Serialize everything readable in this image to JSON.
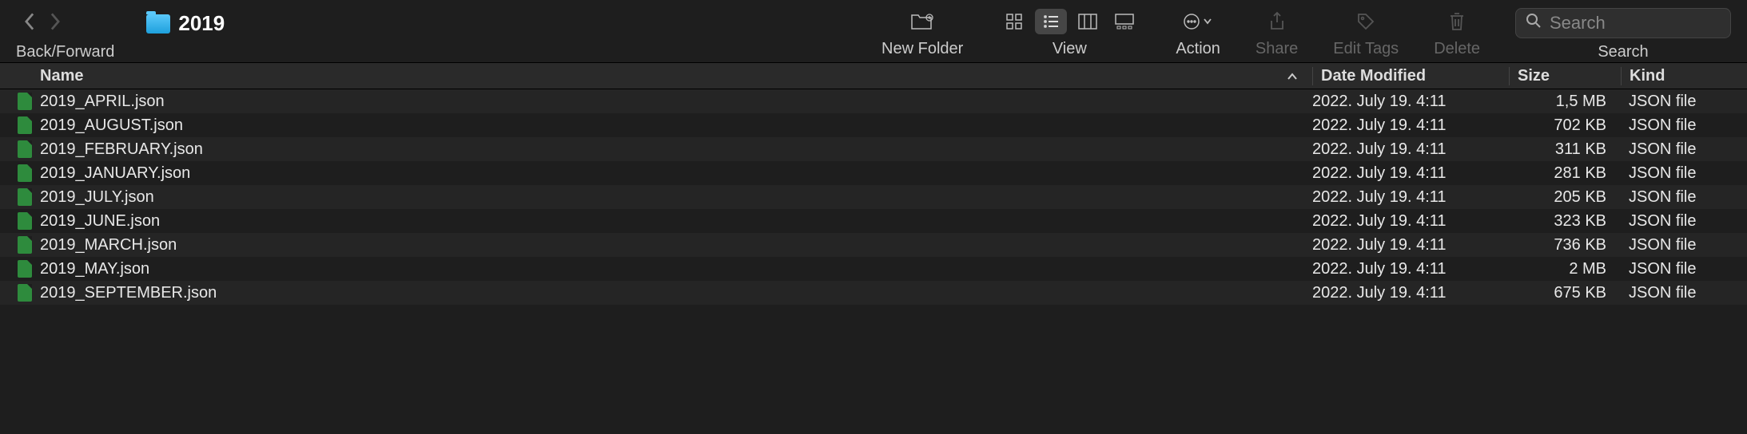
{
  "toolbar": {
    "nav_label": "Back/Forward",
    "title": "2019",
    "new_folder_label": "New Folder",
    "view_label": "View",
    "action_label": "Action",
    "share_label": "Share",
    "edit_tags_label": "Edit Tags",
    "delete_label": "Delete",
    "search_label": "Search",
    "search_placeholder": "Search"
  },
  "columns": {
    "name": "Name",
    "date": "Date Modified",
    "size": "Size",
    "kind": "Kind"
  },
  "files": [
    {
      "name": "2019_APRIL.json",
      "date": "2022. July 19. 4:11",
      "size": "1,5 MB",
      "kind": "JSON file"
    },
    {
      "name": "2019_AUGUST.json",
      "date": "2022. July 19. 4:11",
      "size": "702 KB",
      "kind": "JSON file"
    },
    {
      "name": "2019_FEBRUARY.json",
      "date": "2022. July 19. 4:11",
      "size": "311 KB",
      "kind": "JSON file"
    },
    {
      "name": "2019_JANUARY.json",
      "date": "2022. July 19. 4:11",
      "size": "281 KB",
      "kind": "JSON file"
    },
    {
      "name": "2019_JULY.json",
      "date": "2022. July 19. 4:11",
      "size": "205 KB",
      "kind": "JSON file"
    },
    {
      "name": "2019_JUNE.json",
      "date": "2022. July 19. 4:11",
      "size": "323 KB",
      "kind": "JSON file"
    },
    {
      "name": "2019_MARCH.json",
      "date": "2022. July 19. 4:11",
      "size": "736 KB",
      "kind": "JSON file"
    },
    {
      "name": "2019_MAY.json",
      "date": "2022. July 19. 4:11",
      "size": "2 MB",
      "kind": "JSON file"
    },
    {
      "name": "2019_SEPTEMBER.json",
      "date": "2022. July 19. 4:11",
      "size": "675 KB",
      "kind": "JSON file"
    }
  ]
}
